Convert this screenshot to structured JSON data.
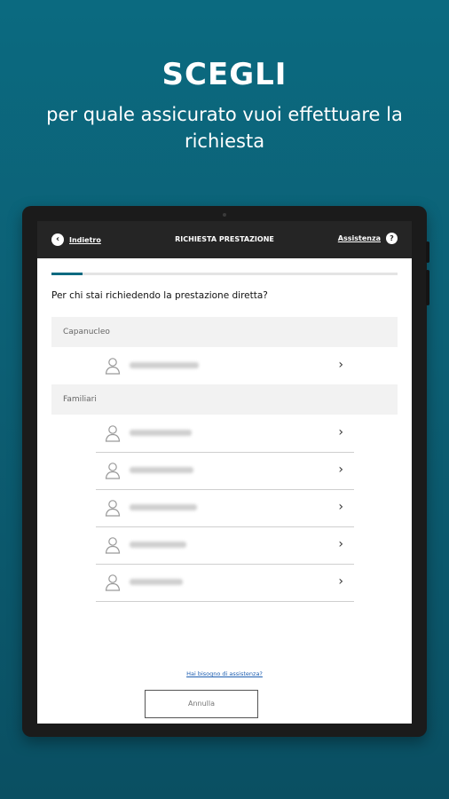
{
  "promo": {
    "title": "SCEGLI",
    "subtitle": "per quale assicurato vuoi effettuare la richiesta"
  },
  "header": {
    "back_label": "Indietro",
    "title": "RICHIESTA PRESTAZIONE",
    "assist_label": "Assistenza"
  },
  "progress": {
    "value": 0.09,
    "color": "#0b6a80"
  },
  "question": "Per chi stai richiedendo la prestazione diretta?",
  "sections": {
    "head": {
      "label": "Capanucleo",
      "rows": [
        {
          "name_blurred": true,
          "icon": "person-icon",
          "chevron": "›"
        }
      ]
    },
    "family": {
      "label": "Familiari",
      "rows": [
        {
          "name_blurred": true,
          "icon": "person-icon",
          "chevron": "›"
        },
        {
          "name_blurred": true,
          "icon": "person-icon",
          "chevron": "›"
        },
        {
          "name_blurred": true,
          "icon": "person-icon",
          "chevron": "›"
        },
        {
          "name_blurred": true,
          "icon": "person-icon",
          "chevron": "›"
        },
        {
          "name_blurred": true,
          "icon": "person-icon",
          "chevron": "›"
        }
      ]
    }
  },
  "help_link": "Hai bisogno di assistenza?",
  "cancel_label": "Annulla",
  "colors": {
    "background": "#0b6a80",
    "header": "#252525",
    "link": "#1c5db0"
  }
}
